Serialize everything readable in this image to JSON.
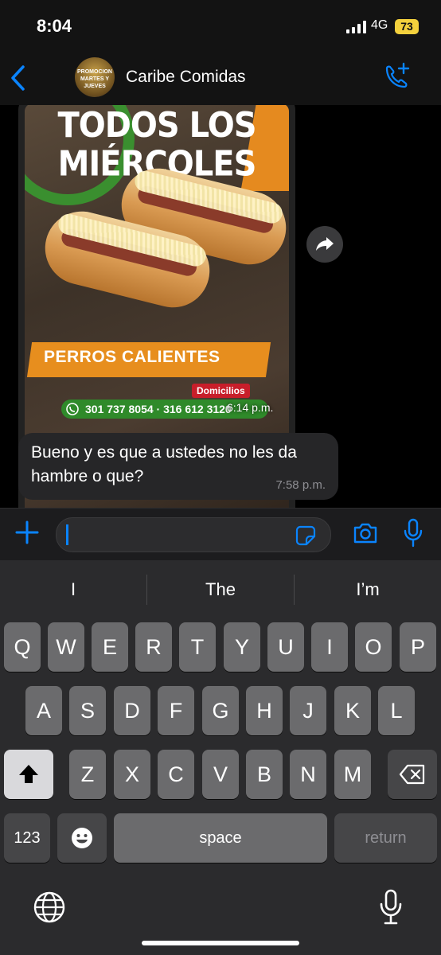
{
  "status_bar": {
    "time": "8:04",
    "network": "4G",
    "battery": "73"
  },
  "header": {
    "chat_name": "Caribe Comidas",
    "avatar_text": "PROMOCION MARTES Y JUEVES"
  },
  "image_message": {
    "title_line": "TODOS LOS MIÉRCOLES",
    "banner": "PERROS CALIENTES",
    "delivery_label": "Domicilios",
    "phones": "301 737 8054 · 316 612 3120",
    "time": "6:14 p.m."
  },
  "text_message": {
    "text": "Bueno y es que a ustedes no les da hambre o que?",
    "time": "7:58 p.m."
  },
  "input": {
    "placeholder": ""
  },
  "keyboard": {
    "predictions": [
      "I",
      "The",
      "I’m"
    ],
    "row1": [
      "Q",
      "W",
      "E",
      "R",
      "T",
      "Y",
      "U",
      "I",
      "O",
      "P"
    ],
    "row2": [
      "A",
      "S",
      "D",
      "F",
      "G",
      "H",
      "J",
      "K",
      "L"
    ],
    "row3": [
      "Z",
      "X",
      "C",
      "V",
      "B",
      "N",
      "M"
    ],
    "numbers_label": "123",
    "space_label": "space",
    "return_label": "return"
  },
  "colors": {
    "accent": "#0a84ff",
    "bubble": "#262628",
    "battery": "#f4d13d"
  }
}
